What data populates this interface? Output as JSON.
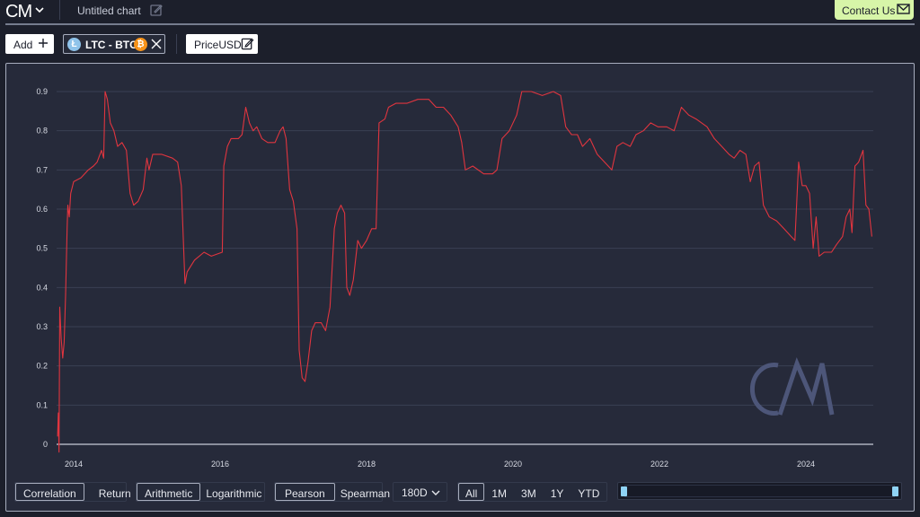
{
  "app": {
    "logo_text": "CM",
    "chart_title": "Untitled chart",
    "contact_label": "Contact Us"
  },
  "toolbar": {
    "add_label": "Add",
    "pair_label": "LTC - BTC",
    "pair_base_symbol": "Ł",
    "pair_quote_symbol": "₿",
    "metric_label": "PriceUSD"
  },
  "controls": {
    "mode": {
      "options": [
        "Correlation",
        "Return"
      ],
      "selected": "Correlation"
    },
    "scale": {
      "options": [
        "Arithmetic",
        "Logarithmic"
      ],
      "selected": "Arithmetic"
    },
    "method": {
      "options": [
        "Pearson",
        "Spearman"
      ],
      "selected": "Pearson"
    },
    "window": {
      "selected": "180D"
    },
    "ranges": {
      "options": [
        "All",
        "1M",
        "3M",
        "1Y",
        "YTD"
      ],
      "selected": "All"
    },
    "slider": {
      "start": 0,
      "end": 1
    }
  },
  "colors": {
    "series": "#e0353f",
    "accent": "#d7f5a8",
    "handle": "#8fd3f5",
    "watermark": "#4d5679"
  },
  "watermark": "CM",
  "chart_data": {
    "type": "line",
    "title": "",
    "xlabel": "",
    "ylabel": "",
    "series": [
      {
        "name": "LTC - BTC 180D Pearson Correlation",
        "points": [
          [
            2013.78,
            0.02
          ],
          [
            2013.79,
            0.08
          ],
          [
            2013.8,
            -0.02
          ],
          [
            2013.81,
            0.35
          ],
          [
            2013.83,
            0.27
          ],
          [
            2013.85,
            0.22
          ],
          [
            2013.87,
            0.26
          ],
          [
            2013.89,
            0.38
          ],
          [
            2013.91,
            0.55
          ],
          [
            2013.92,
            0.61
          ],
          [
            2013.94,
            0.58
          ],
          [
            2013.96,
            0.64
          ],
          [
            2014.0,
            0.67
          ],
          [
            2014.1,
            0.68
          ],
          [
            2014.2,
            0.7
          ],
          [
            2014.27,
            0.71
          ],
          [
            2014.32,
            0.72
          ],
          [
            2014.38,
            0.75
          ],
          [
            2014.41,
            0.73
          ],
          [
            2014.43,
            0.9
          ],
          [
            2014.46,
            0.88
          ],
          [
            2014.5,
            0.82
          ],
          [
            2014.55,
            0.8
          ],
          [
            2014.6,
            0.76
          ],
          [
            2014.66,
            0.77
          ],
          [
            2014.72,
            0.75
          ],
          [
            2014.77,
            0.64
          ],
          [
            2014.82,
            0.61
          ],
          [
            2014.88,
            0.62
          ],
          [
            2014.95,
            0.65
          ],
          [
            2015.0,
            0.73
          ],
          [
            2015.03,
            0.7
          ],
          [
            2015.08,
            0.74
          ],
          [
            2015.2,
            0.74
          ],
          [
            2015.35,
            0.73
          ],
          [
            2015.42,
            0.72
          ],
          [
            2015.47,
            0.66
          ],
          [
            2015.52,
            0.41
          ],
          [
            2015.55,
            0.44
          ],
          [
            2015.65,
            0.47
          ],
          [
            2015.78,
            0.49
          ],
          [
            2015.88,
            0.48
          ],
          [
            2016.03,
            0.49
          ],
          [
            2016.05,
            0.71
          ],
          [
            2016.1,
            0.76
          ],
          [
            2016.15,
            0.78
          ],
          [
            2016.25,
            0.78
          ],
          [
            2016.3,
            0.79
          ],
          [
            2016.35,
            0.86
          ],
          [
            2016.4,
            0.82
          ],
          [
            2016.45,
            0.8
          ],
          [
            2016.5,
            0.81
          ],
          [
            2016.57,
            0.78
          ],
          [
            2016.65,
            0.77
          ],
          [
            2016.75,
            0.77
          ],
          [
            2016.82,
            0.8
          ],
          [
            2016.86,
            0.81
          ],
          [
            2016.9,
            0.78
          ],
          [
            2016.95,
            0.65
          ],
          [
            2017.0,
            0.62
          ],
          [
            2017.05,
            0.55
          ],
          [
            2017.08,
            0.24
          ],
          [
            2017.12,
            0.17
          ],
          [
            2017.16,
            0.16
          ],
          [
            2017.2,
            0.21
          ],
          [
            2017.25,
            0.29
          ],
          [
            2017.3,
            0.31
          ],
          [
            2017.38,
            0.31
          ],
          [
            2017.44,
            0.29
          ],
          [
            2017.5,
            0.35
          ],
          [
            2017.56,
            0.55
          ],
          [
            2017.6,
            0.59
          ],
          [
            2017.65,
            0.61
          ],
          [
            2017.7,
            0.59
          ],
          [
            2017.73,
            0.4
          ],
          [
            2017.77,
            0.38
          ],
          [
            2017.82,
            0.42
          ],
          [
            2017.88,
            0.52
          ],
          [
            2017.93,
            0.5
          ],
          [
            2018.0,
            0.52
          ],
          [
            2018.07,
            0.55
          ],
          [
            2018.13,
            0.55
          ],
          [
            2018.17,
            0.82
          ],
          [
            2018.25,
            0.83
          ],
          [
            2018.3,
            0.86
          ],
          [
            2018.4,
            0.87
          ],
          [
            2018.55,
            0.87
          ],
          [
            2018.7,
            0.88
          ],
          [
            2018.85,
            0.88
          ],
          [
            2018.95,
            0.86
          ],
          [
            2019.05,
            0.86
          ],
          [
            2019.15,
            0.84
          ],
          [
            2019.25,
            0.81
          ],
          [
            2019.3,
            0.77
          ],
          [
            2019.35,
            0.7
          ],
          [
            2019.45,
            0.71
          ],
          [
            2019.6,
            0.69
          ],
          [
            2019.72,
            0.69
          ],
          [
            2019.78,
            0.7
          ],
          [
            2019.85,
            0.78
          ],
          [
            2019.95,
            0.8
          ],
          [
            2020.05,
            0.84
          ],
          [
            2020.12,
            0.9
          ],
          [
            2020.25,
            0.9
          ],
          [
            2020.4,
            0.89
          ],
          [
            2020.55,
            0.9
          ],
          [
            2020.65,
            0.89
          ],
          [
            2020.72,
            0.81
          ],
          [
            2020.8,
            0.79
          ],
          [
            2020.88,
            0.79
          ],
          [
            2020.95,
            0.76
          ],
          [
            2021.05,
            0.78
          ],
          [
            2021.15,
            0.74
          ],
          [
            2021.25,
            0.72
          ],
          [
            2021.35,
            0.7
          ],
          [
            2021.42,
            0.76
          ],
          [
            2021.5,
            0.77
          ],
          [
            2021.6,
            0.76
          ],
          [
            2021.68,
            0.79
          ],
          [
            2021.78,
            0.8
          ],
          [
            2021.88,
            0.82
          ],
          [
            2021.98,
            0.81
          ],
          [
            2022.1,
            0.81
          ],
          [
            2022.2,
            0.8
          ],
          [
            2022.3,
            0.86
          ],
          [
            2022.4,
            0.84
          ],
          [
            2022.5,
            0.83
          ],
          [
            2022.65,
            0.81
          ],
          [
            2022.75,
            0.78
          ],
          [
            2022.85,
            0.76
          ],
          [
            2022.95,
            0.74
          ],
          [
            2023.02,
            0.73
          ],
          [
            2023.1,
            0.75
          ],
          [
            2023.18,
            0.74
          ],
          [
            2023.24,
            0.67
          ],
          [
            2023.3,
            0.71
          ],
          [
            2023.36,
            0.72
          ],
          [
            2023.42,
            0.61
          ],
          [
            2023.5,
            0.58
          ],
          [
            2023.6,
            0.57
          ],
          [
            2023.7,
            0.55
          ],
          [
            2023.8,
            0.53
          ],
          [
            2023.85,
            0.52
          ],
          [
            2023.9,
            0.72
          ],
          [
            2023.95,
            0.66
          ],
          [
            2024.0,
            0.66
          ],
          [
            2024.05,
            0.64
          ],
          [
            2024.1,
            0.5
          ],
          [
            2024.14,
            0.58
          ],
          [
            2024.18,
            0.48
          ],
          [
            2024.25,
            0.49
          ],
          [
            2024.35,
            0.49
          ],
          [
            2024.42,
            0.51
          ],
          [
            2024.5,
            0.53
          ],
          [
            2024.55,
            0.58
          ],
          [
            2024.6,
            0.6
          ],
          [
            2024.63,
            0.54
          ],
          [
            2024.67,
            0.71
          ],
          [
            2024.72,
            0.72
          ],
          [
            2024.78,
            0.75
          ],
          [
            2024.82,
            0.61
          ],
          [
            2024.86,
            0.6
          ],
          [
            2024.9,
            0.53
          ]
        ]
      }
    ],
    "x_ticks": [
      "2014",
      "2016",
      "2018",
      "2020",
      "2022",
      "2024"
    ],
    "x_tick_values": [
      2014,
      2016,
      2018,
      2020,
      2022,
      2024
    ],
    "y_ticks": [
      "0",
      "0.1",
      "0.2",
      "0.3",
      "0.4",
      "0.5",
      "0.6",
      "0.7",
      "0.8",
      "0.9"
    ],
    "y_tick_values": [
      0,
      0.1,
      0.2,
      0.3,
      0.4,
      0.5,
      0.6,
      0.7,
      0.8,
      0.9
    ],
    "xlim": [
      2013.72,
      2024.92
    ],
    "ylim": [
      0,
      0.9
    ],
    "grid": true,
    "legend": "none"
  }
}
